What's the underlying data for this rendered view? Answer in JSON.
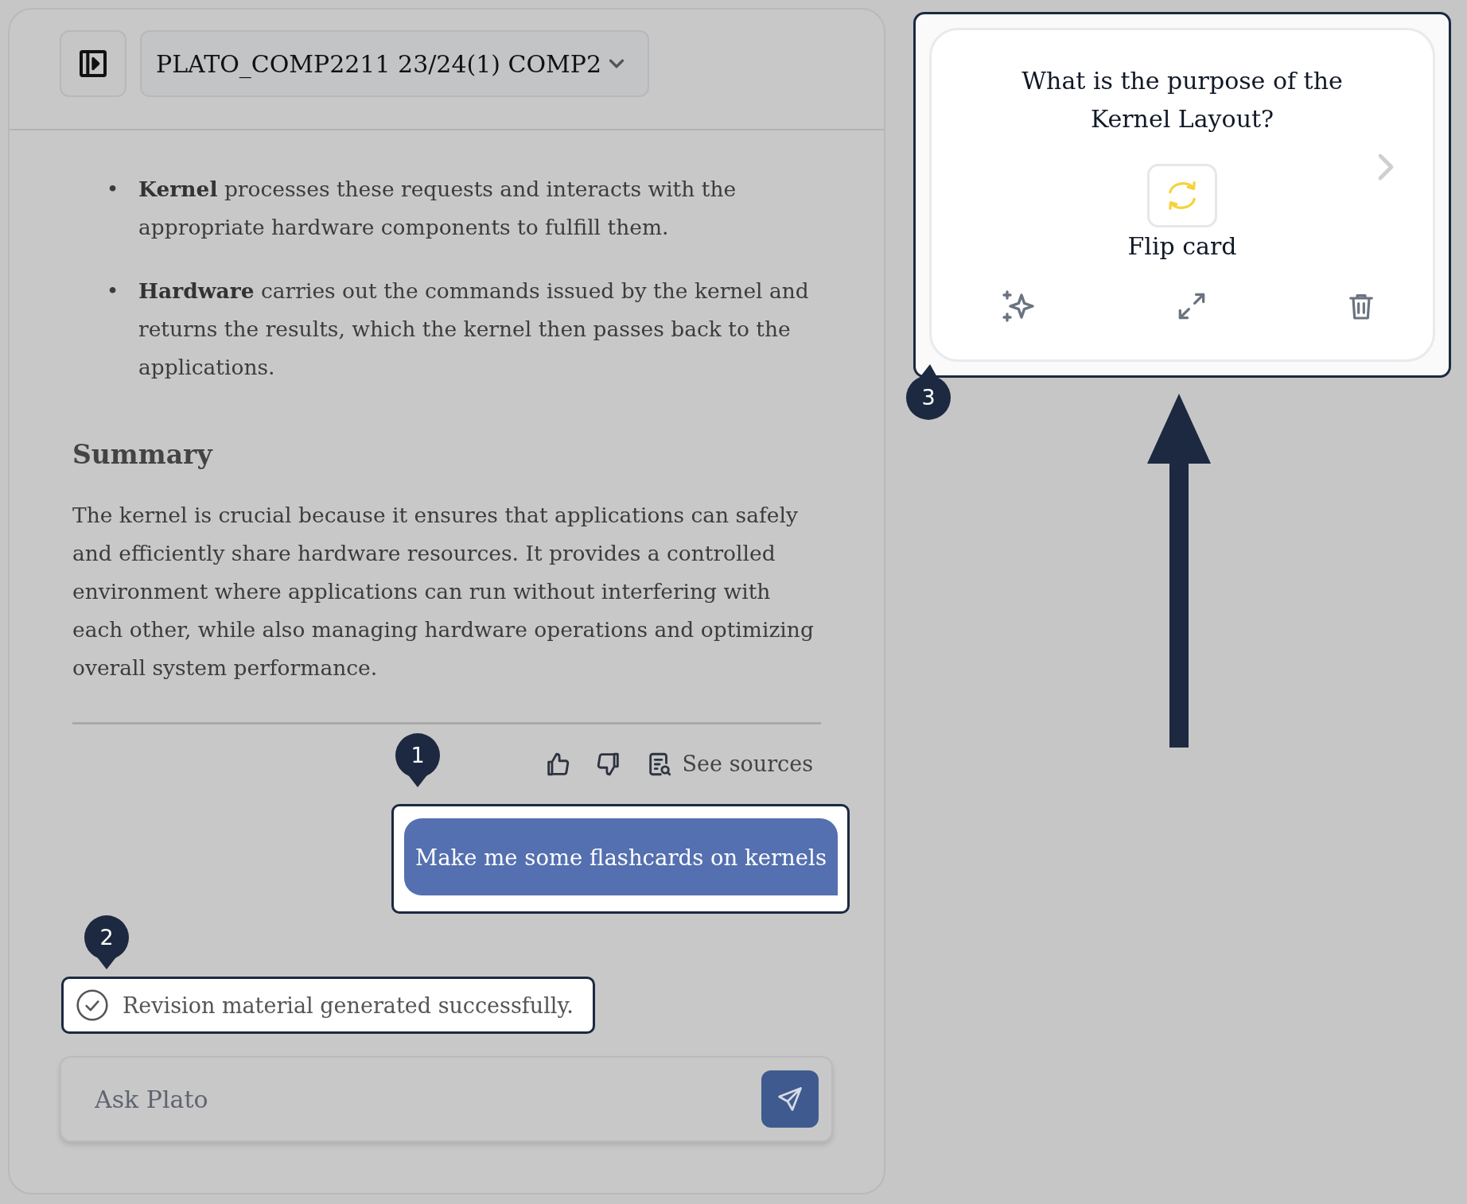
{
  "header": {
    "course_selector": "PLATO_COMP2211 23/24(1) COMP2"
  },
  "response": {
    "bullets": [
      {
        "marker": "•",
        "text": "**Kernel** processes these requests and interacts with the appropriate hardware components to fulfill them."
      },
      {
        "marker": "•",
        "text": "**Hardware** carries out the commands issued by the kernel and returns the results, which the kernel then passes back to the applications."
      }
    ],
    "summary_heading": "Summary",
    "summary_text": "The kernel is crucial because it ensures that applications can safely and efficiently share hardware resources. It provides a controlled environment where applications can run without interfering with each other, while also managing hardware operations and optimizing overall system performance."
  },
  "actions": {
    "see_sources": "See sources"
  },
  "user_message": {
    "text": "Make me some flashcards on kernels",
    "marker": "1"
  },
  "toast": {
    "text": "Revision material generated successfully.",
    "marker": "2"
  },
  "input": {
    "placeholder": "Ask Plato"
  },
  "flashcard": {
    "question": "What is the purpose of the Kernel Layout?",
    "flip_label": "Flip card",
    "marker": "3"
  }
}
